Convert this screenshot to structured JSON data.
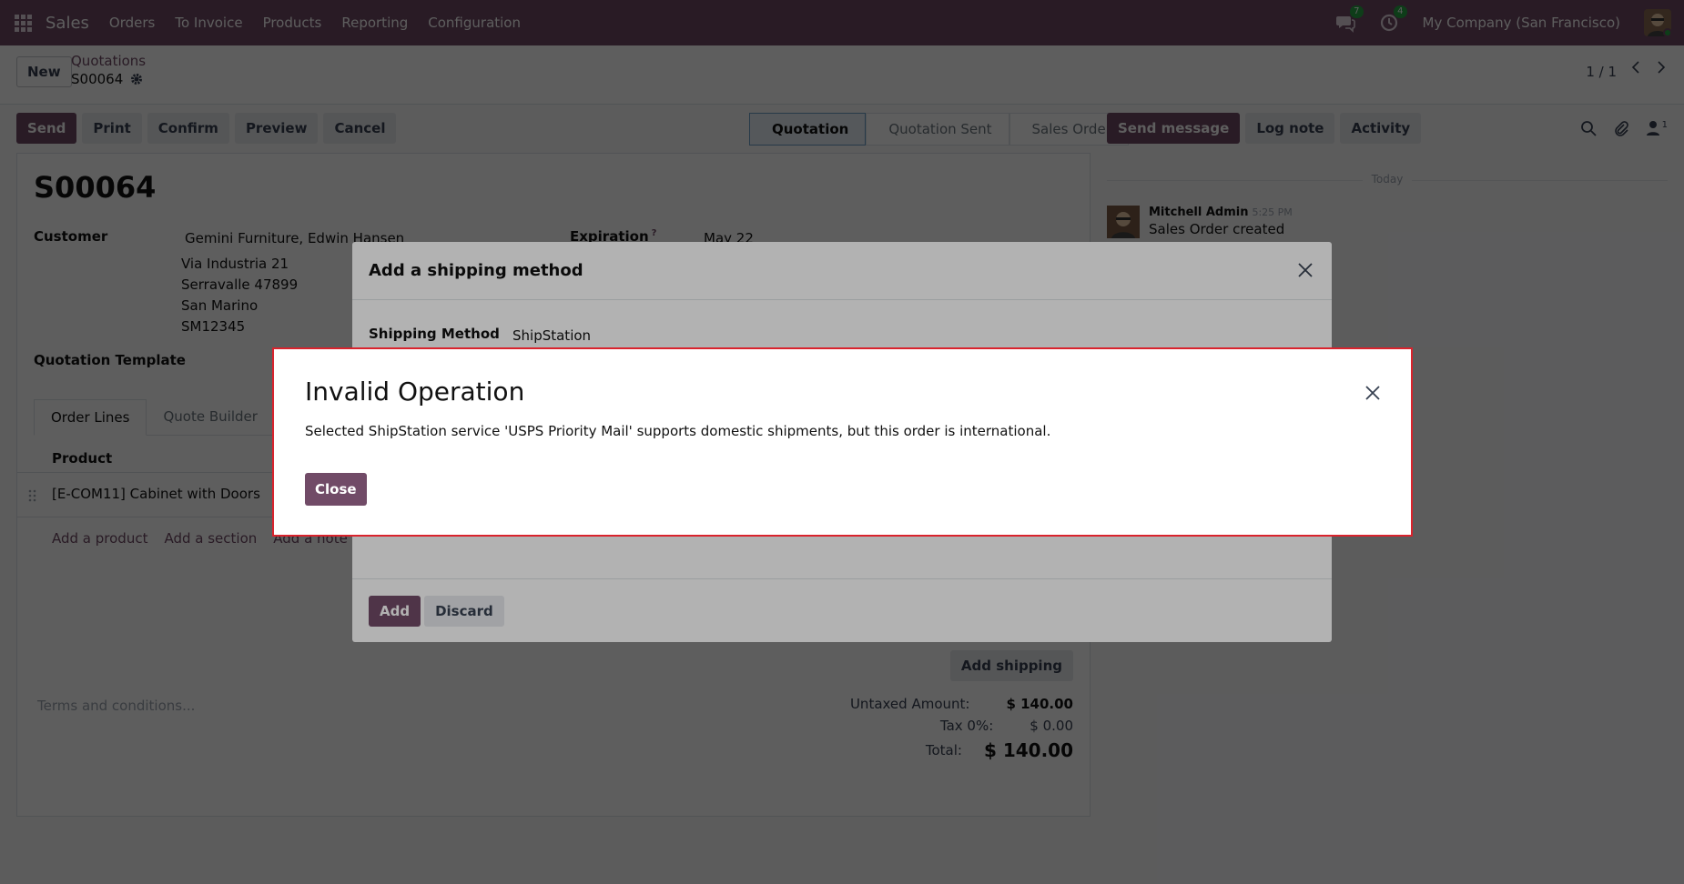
{
  "navbar": {
    "app_name": "Sales",
    "menu": [
      "Orders",
      "To Invoice",
      "Products",
      "Reporting",
      "Configuration"
    ],
    "messages_count": "7",
    "activities_count": "4",
    "company": "My Company (San Francisco)"
  },
  "control": {
    "new_label": "New",
    "breadcrumb_parent": "Quotations",
    "breadcrumb_current": "S00064",
    "pager": "1 / 1"
  },
  "actions": {
    "send": "Send",
    "print": "Print",
    "confirm": "Confirm",
    "preview": "Preview",
    "cancel": "Cancel"
  },
  "statusbar": [
    "Quotation",
    "Quotation Sent",
    "Sales Order"
  ],
  "chatter": {
    "send_message": "Send message",
    "log_note": "Log note",
    "activity": "Activity",
    "followers_count": "1",
    "today": "Today",
    "author": "Mitchell Admin",
    "time": "5:25 PM",
    "message": "Sales Order created"
  },
  "form": {
    "name": "S00064",
    "customer_label": "Customer",
    "customer": "Gemini Furniture, Edwin Hansen",
    "address": [
      "Via Industria 21",
      "Serravalle 47899",
      "San Marino",
      "SM12345"
    ],
    "expiration_label": "Expiration",
    "expiration_help": "?",
    "expiration": "May 22",
    "template_label": "Quotation Template",
    "tabs": [
      "Order Lines",
      "Quote Builder"
    ],
    "product_header": "Product",
    "line_product": "[E-COM11] Cabinet with Doors",
    "add_product": "Add a product",
    "add_section": "Add a section",
    "add_note": "Add a note",
    "add_shipping": "Add shipping",
    "terms_placeholder": "Terms and conditions...",
    "untaxed_label": "Untaxed Amount:",
    "untaxed": "$ 140.00",
    "tax_label": "Tax 0%:",
    "tax": "$ 0.00",
    "total_label": "Total:",
    "total": "$ 140.00"
  },
  "shipping_dialog": {
    "title": "Add a shipping method",
    "method_label": "Shipping Method",
    "method_value": "ShipStation",
    "add": "Add",
    "discard": "Discard"
  },
  "error_dialog": {
    "title": "Invalid Operation",
    "message": "Selected ShipStation service 'USPS Priority Mail' supports domestic shipments, but this order is international.",
    "close": "Close"
  }
}
